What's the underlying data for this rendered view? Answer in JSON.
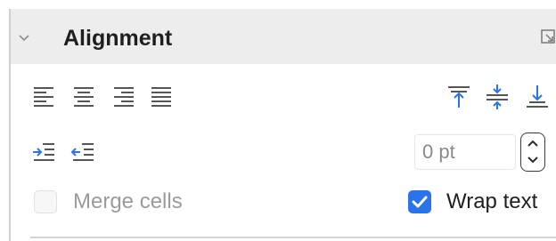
{
  "panel": {
    "title": "Alignment",
    "expanded": true
  },
  "horizontal_alignment": {
    "buttons": [
      "align-left",
      "align-center",
      "align-right",
      "justify"
    ]
  },
  "vertical_alignment": {
    "buttons": [
      "align-top",
      "center-vertically",
      "align-bottom"
    ]
  },
  "indent": {
    "buttons": [
      "increase-indent",
      "decrease-indent"
    ],
    "value": "0 pt"
  },
  "options": {
    "merge_cells_label": "Merge cells",
    "merge_cells_checked": false,
    "merge_cells_enabled": false,
    "wrap_text_label": "Wrap text",
    "wrap_text_checked": true
  },
  "colors": {
    "accent": "#2a73e8",
    "header_bg": "#ededed",
    "icon_gray": "#555555",
    "icon_blue": "#2a73e8"
  }
}
